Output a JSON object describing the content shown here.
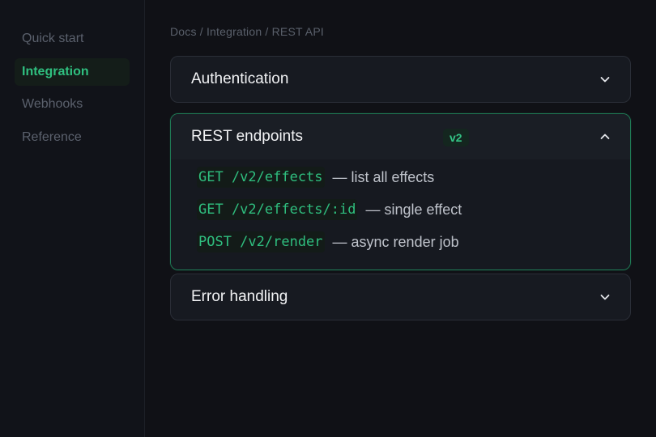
{
  "sidebar": {
    "items": [
      {
        "label": "Quick start",
        "active": false
      },
      {
        "label": "Integration",
        "active": true
      },
      {
        "label": "Webhooks",
        "active": false
      },
      {
        "label": "Reference",
        "active": false
      }
    ]
  },
  "breadcrumb": "Docs / Integration / REST API",
  "panels": [
    {
      "title": "Authentication",
      "expanded": false
    },
    {
      "title": "REST endpoints",
      "badge": "v2",
      "expanded": true,
      "endpoints": [
        {
          "code": "GET /v2/effects",
          "desc": "— list all effects"
        },
        {
          "code": "GET /v2/effects/:id",
          "desc": "— single effect"
        },
        {
          "code": "POST /v2/render",
          "desc": "— async render job"
        }
      ]
    },
    {
      "title": "Error handling",
      "expanded": false
    }
  ],
  "icons": {
    "collapsed": "chevron-down-icon",
    "expanded": "chevron-up-icon"
  },
  "colors": {
    "accent": "#2fbf7f",
    "background": "#101116",
    "panel": "#171a21",
    "open_border": "#1f7a55"
  }
}
